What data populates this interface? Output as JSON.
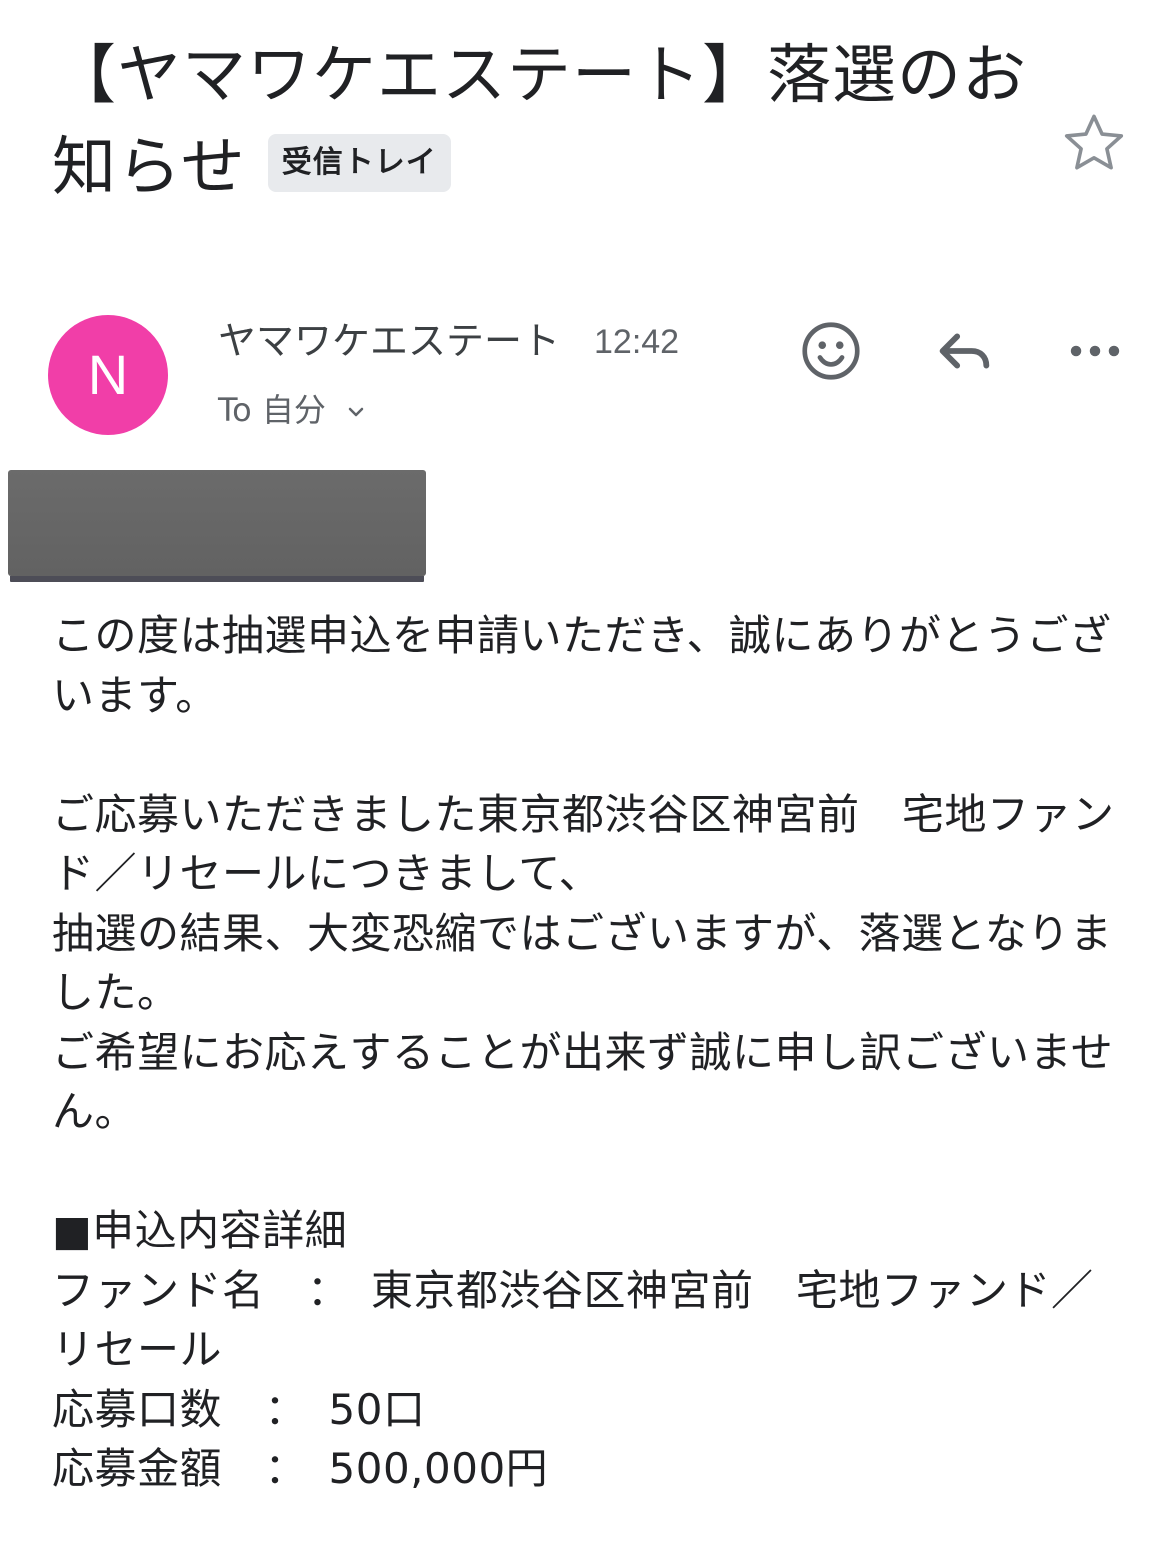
{
  "email": {
    "subject": "【ヤマワケエステート】落選のお知らせ",
    "label": "受信トレイ",
    "sender_initial": "N",
    "sender_name": "ヤマワケエステート",
    "time": "12:42",
    "to_line": "To 自分",
    "colors": {
      "avatar": "#f13ea8",
      "chip_bg": "#e8eaed",
      "redaction": "#666666"
    },
    "icons": [
      "star-icon",
      "emoji-icon",
      "reply-icon",
      "more-icon",
      "chevron-down-icon"
    ]
  },
  "body": {
    "para1": "この度は抽選申込を申請いただき、誠にありがとうございます。",
    "para2_line1": "ご応募いただきました東京都渋谷区神宮前　宅地ファンド／リセールにつきまして、",
    "para2_line2": "抽選の結果、大変恐縮ではございますが、落選となりました。",
    "para2_line3": "ご希望にお応えすることが出来ず誠に申し訳ございません。",
    "details_header": "■申込内容詳細",
    "fund_name_row": "ファンド名　：　東京都渋谷区神宮前　宅地ファンド／リセール",
    "units_row": "応募口数　：　50口",
    "amount_row": "応募金額　：　500,000円"
  }
}
